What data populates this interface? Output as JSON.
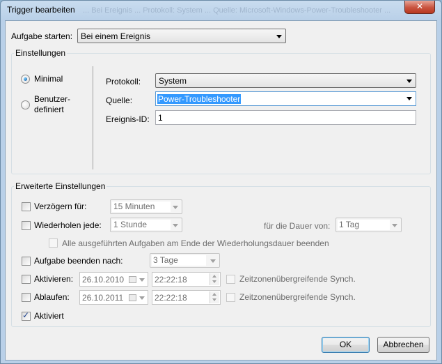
{
  "window": {
    "title": "Trigger bearbeiten",
    "ghost_title": "... Bei Ereignis ... Protokoll: System ... Quelle: Microsoft-Windows-Power-Troubleshooter ...",
    "close_glyph": "✕"
  },
  "start": {
    "label": "Aufgabe starten:",
    "value": "Bei einem Ereignis"
  },
  "settings": {
    "title": "Einstellungen",
    "radio_minimal": "Minimal",
    "radio_custom_line1": "Benutzer-",
    "radio_custom_line2": "definiert",
    "protocol_label": "Protokoll:",
    "protocol_value": "System",
    "source_label": "Quelle:",
    "source_value": "Power-Troubleshooter",
    "event_id_label": "Ereignis-ID:",
    "event_id_value": "1"
  },
  "advanced": {
    "title": "Erweiterte Einstellungen",
    "delay_label": "Verzögern für:",
    "delay_value": "15 Minuten",
    "repeat_label": "Wiederholen jede:",
    "repeat_value": "1 Stunde",
    "duration_label": "für die Dauer von:",
    "duration_value": "1 Tag",
    "stop_all_label": "Alle ausgeführten Aufgaben am Ende der Wiederholungsdauer beenden",
    "stop_after_label": "Aufgabe beenden nach:",
    "stop_after_value": "3 Tage",
    "activate_label": "Aktivieren:",
    "activate_date": "26.10.2010",
    "activate_time": "22:22:18",
    "activate_sync": "Zeitzonenübergreifende Synch.",
    "expire_label": "Ablaufen:",
    "expire_date": "26.10.2011",
    "expire_time": "22:22:18",
    "expire_sync": "Zeitzonenübergreifende Synch.",
    "enabled_label": "Aktiviert",
    "check_mark": "✓"
  },
  "buttons": {
    "ok": "OK",
    "cancel": "Abbrechen"
  }
}
